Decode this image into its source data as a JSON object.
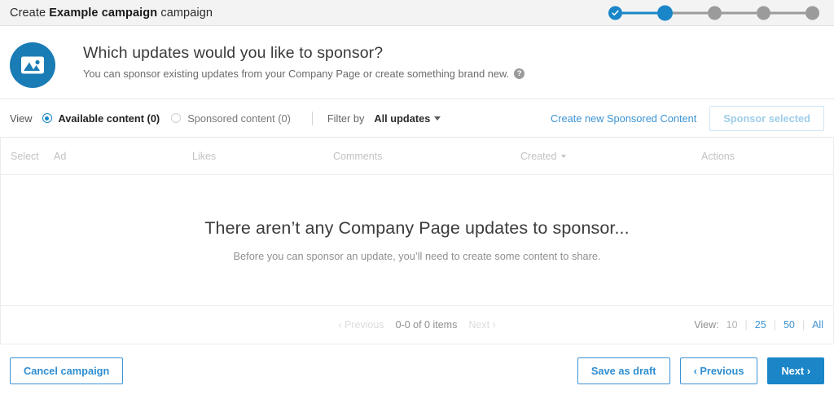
{
  "topbar": {
    "title_prefix": "Create ",
    "campaign_name": "Example campaign",
    "title_suffix": " campaign",
    "stepper": {
      "total_steps": 5,
      "current_step": 2,
      "completed_icon": "check-icon",
      "active_color": "#1a86c8",
      "inactive_color": "#9b9b9b"
    }
  },
  "hero": {
    "icon": "image-icon",
    "icon_bg": "#1a7cb5",
    "title": "Which updates would you like to sponsor?",
    "subtitle": "You can sponsor existing updates from your Company Page or create something brand new.",
    "help_icon": "question-mark-icon"
  },
  "toolbar": {
    "view_label": "View",
    "options": [
      {
        "label": "Available content (0)",
        "selected": true
      },
      {
        "label": "Sponsored content (0)",
        "selected": false
      }
    ],
    "filter_by_label": "Filter by",
    "filter_value": "All updates",
    "create_link": "Create new Sponsored Content",
    "sponsor_button": "Sponsor selected",
    "sponsor_button_disabled": true,
    "accent_color": "#1a86c8"
  },
  "table": {
    "columns": [
      "Select",
      "Ad",
      "Likes",
      "Comments",
      "Created",
      "Actions"
    ],
    "sorted_column": "Created",
    "sort_icon": "caret-down-icon",
    "rows": [],
    "empty_title": "There aren’t any Company Page updates to sponsor...",
    "empty_subtitle": "Before you can sponsor an update, you’ll need to create some content to share."
  },
  "pagination": {
    "previous_label": "‹ Previous",
    "previous_disabled": true,
    "count_label": "0-0 of 0 items",
    "next_label": "Next ›",
    "next_disabled": true,
    "view_label": "View:",
    "page_sizes": [
      {
        "label": "10",
        "current": true
      },
      {
        "label": "25",
        "current": false
      },
      {
        "label": "50",
        "current": false
      },
      {
        "label": "All",
        "current": false
      }
    ],
    "separator": "|"
  },
  "footer": {
    "cancel_label": "Cancel campaign",
    "save_draft_label": "Save as draft",
    "previous_label": "‹ Previous",
    "next_label": "Next ›"
  }
}
